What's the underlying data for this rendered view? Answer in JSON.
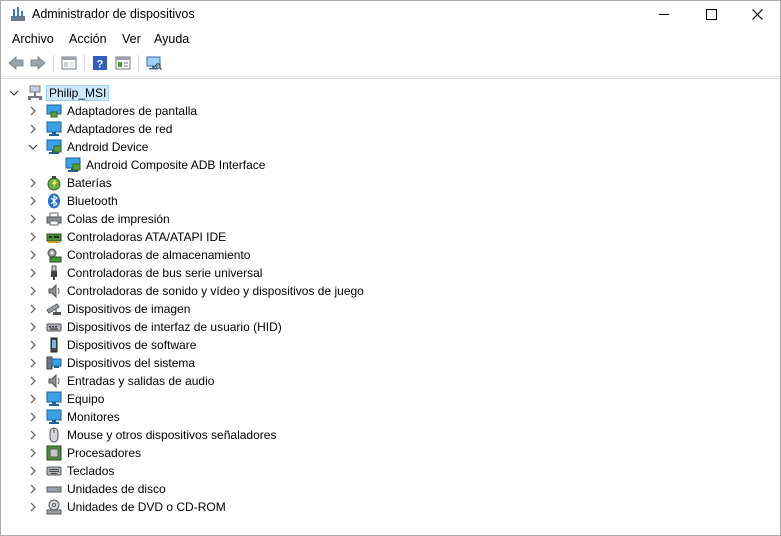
{
  "window": {
    "title": "Administrador de dispositivos"
  },
  "menu": [
    "Archivo",
    "Acción",
    "Ver",
    "Ayuda"
  ],
  "tree": {
    "root": "Philip_MSI",
    "categories": [
      {
        "label": "Adaptadores de pantalla",
        "icon": "display-adapter-icon",
        "expanded": false
      },
      {
        "label": "Adaptadores de red",
        "icon": "network-adapter-icon",
        "expanded": false
      },
      {
        "label": "Android Device",
        "icon": "android-device-icon",
        "expanded": true,
        "children": [
          {
            "label": "Android Composite ADB Interface",
            "icon": "adb-interface-icon"
          }
        ]
      },
      {
        "label": "Baterías",
        "icon": "battery-icon",
        "expanded": false
      },
      {
        "label": "Bluetooth",
        "icon": "bluetooth-icon",
        "expanded": false
      },
      {
        "label": "Colas de impresión",
        "icon": "print-queue-icon",
        "expanded": false
      },
      {
        "label": "Controladoras ATA/ATAPI IDE",
        "icon": "ide-controller-icon",
        "expanded": false
      },
      {
        "label": "Controladoras de almacenamiento",
        "icon": "storage-controller-icon",
        "expanded": false
      },
      {
        "label": "Controladoras de bus serie universal",
        "icon": "usb-icon",
        "expanded": false
      },
      {
        "label": "Controladoras de sonido y vídeo y dispositivos de juego",
        "icon": "speaker-icon",
        "expanded": false
      },
      {
        "label": "Dispositivos de imagen",
        "icon": "camera-icon",
        "expanded": false
      },
      {
        "label": "Dispositivos de interfaz de usuario (HID)",
        "icon": "hid-icon",
        "expanded": false
      },
      {
        "label": "Dispositivos de software",
        "icon": "software-device-icon",
        "expanded": false
      },
      {
        "label": "Dispositivos del sistema",
        "icon": "system-device-icon",
        "expanded": false
      },
      {
        "label": "Entradas y salidas de audio",
        "icon": "audio-io-icon",
        "expanded": false
      },
      {
        "label": "Equipo",
        "icon": "computer-icon",
        "expanded": false
      },
      {
        "label": "Monitores",
        "icon": "monitor-icon",
        "expanded": false
      },
      {
        "label": "Mouse y otros dispositivos señaladores",
        "icon": "mouse-icon",
        "expanded": false
      },
      {
        "label": "Procesadores",
        "icon": "processor-icon",
        "expanded": false
      },
      {
        "label": "Teclados",
        "icon": "keyboard-icon",
        "expanded": false
      },
      {
        "label": "Unidades de disco",
        "icon": "disk-drive-icon",
        "expanded": false
      },
      {
        "label": "Unidades de DVD o CD-ROM",
        "icon": "dvd-icon",
        "expanded": false
      }
    ]
  }
}
